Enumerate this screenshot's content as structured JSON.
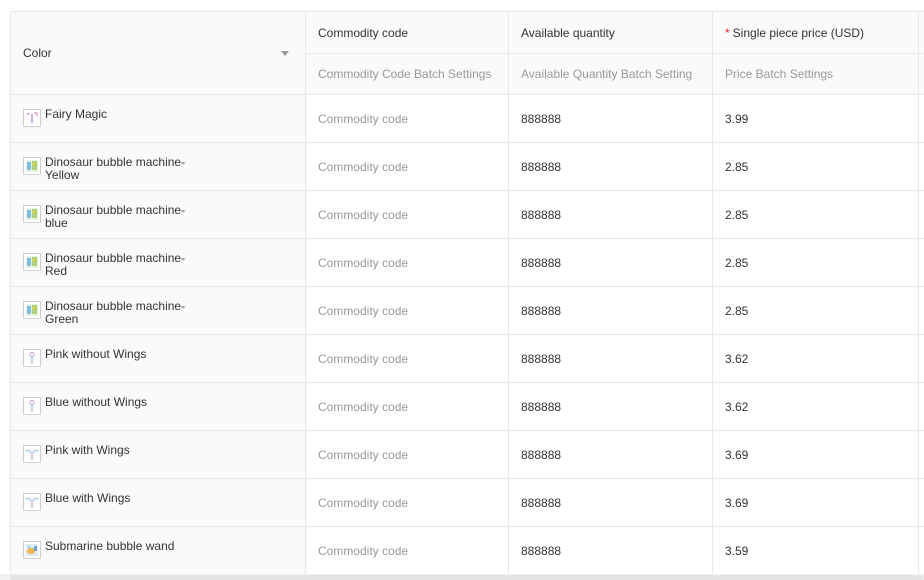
{
  "table": {
    "headers": {
      "color": "Color",
      "code": "Commodity code",
      "qty": "Available quantity",
      "price_required": "*",
      "price": "Single piece price (USD)"
    },
    "batch": {
      "code": "Commodity Code Batch Settings",
      "qty": "Available Quantity Batch Setting",
      "price": "Price Batch Settings"
    },
    "rows": [
      {
        "name": "Fairy Magic",
        "code_placeholder": "Commodity code",
        "qty": "888888",
        "price": "3.99",
        "thumb_icon": "fairy-wand-thumbnail-icon"
      },
      {
        "name": "Dinosaur bubble machine-Yellow",
        "code_placeholder": "Commodity code",
        "qty": "888888",
        "price": "2.85",
        "thumb_icon": "dinosaur-bubble-machine-thumbnail-icon"
      },
      {
        "name": "Dinosaur bubble machine-blue",
        "code_placeholder": "Commodity code",
        "qty": "888888",
        "price": "2.85",
        "thumb_icon": "dinosaur-bubble-machine-thumbnail-icon"
      },
      {
        "name": "Dinosaur bubble machine-Red",
        "code_placeholder": "Commodity code",
        "qty": "888888",
        "price": "2.85",
        "thumb_icon": "dinosaur-bubble-machine-thumbnail-icon"
      },
      {
        "name": "Dinosaur bubble machine-Green",
        "code_placeholder": "Commodity code",
        "qty": "888888",
        "price": "2.85",
        "thumb_icon": "dinosaur-bubble-machine-thumbnail-icon"
      },
      {
        "name": "Pink without Wings",
        "code_placeholder": "Commodity code",
        "qty": "888888",
        "price": "3.62",
        "thumb_icon": "bubble-wand-thumbnail-icon"
      },
      {
        "name": "Blue without Wings",
        "code_placeholder": "Commodity code",
        "qty": "888888",
        "price": "3.62",
        "thumb_icon": "bubble-wand-thumbnail-icon"
      },
      {
        "name": "Pink with Wings",
        "code_placeholder": "Commodity code",
        "qty": "888888",
        "price": "3.69",
        "thumb_icon": "winged-wand-thumbnail-icon"
      },
      {
        "name": "Blue with Wings",
        "code_placeholder": "Commodity code",
        "qty": "888888",
        "price": "3.69",
        "thumb_icon": "winged-wand-thumbnail-icon"
      },
      {
        "name": "Submarine bubble wand",
        "code_placeholder": "Commodity code",
        "qty": "888888",
        "price": "3.59",
        "thumb_icon": "submarine-bubble-wand-thumbnail-icon"
      }
    ]
  },
  "colors": {
    "border": "#e8e8e8",
    "header_bg": "#fafafa",
    "placeholder": "#999999",
    "text": "#333333",
    "required": "#f5222d"
  }
}
